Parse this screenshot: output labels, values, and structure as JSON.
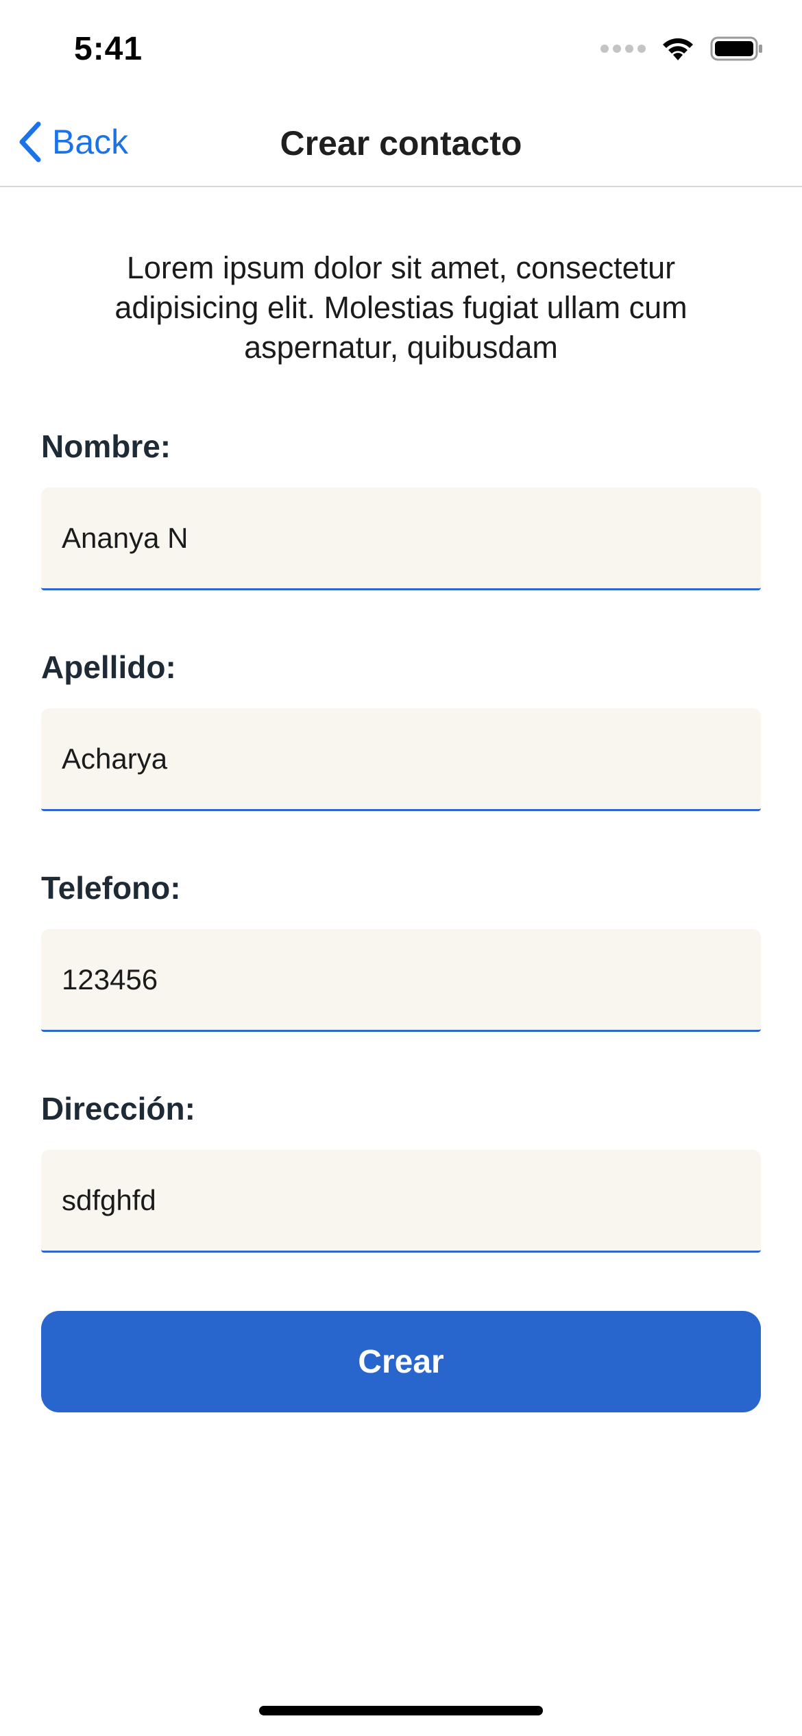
{
  "status_bar": {
    "time": "5:41",
    "icons": [
      "signal-dots-icon",
      "wifi-icon",
      "battery-icon"
    ]
  },
  "nav": {
    "back_label": "Back",
    "title": "Crear contacto",
    "accent_color": "#1a73e8"
  },
  "intro": "Lorem ipsum dolor sit amet, consectetur adipisicing elit. Molestias fugiat ullam cum aspernatur, quibusdam",
  "form": {
    "fields": [
      {
        "label": "Nombre:",
        "value": "Ananya N"
      },
      {
        "label": "Apellido:",
        "value": "Acharya"
      },
      {
        "label": "Telefono:",
        "value": "123456"
      },
      {
        "label": "Dirección:",
        "value": "sdfghfd"
      }
    ],
    "input_background": "#f9f6f0",
    "underline_color": "#2d66cf"
  },
  "actions": {
    "create_label": "Crear",
    "button_color": "#2866cd"
  }
}
